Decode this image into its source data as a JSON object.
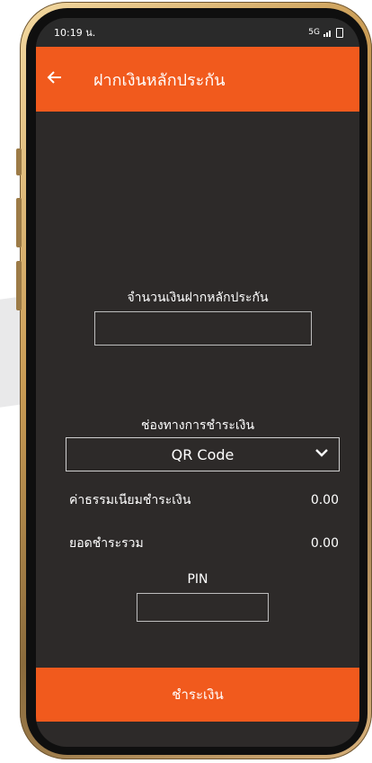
{
  "status_bar": {
    "time": "10:19 น.",
    "network": "5G"
  },
  "app_bar": {
    "title": "ฝากเงินหลักประกัน",
    "back_icon": "arrow-left-icon"
  },
  "form": {
    "amount_label": "จำนวนเงินฝากหลักประกัน",
    "amount_value": "",
    "channel_label": "ช่องทางการชำระเงิน",
    "channel_selected": "QR Code",
    "fee_label": "ค่าธรรมเนียมชำระเงิน",
    "fee_value": "0.00",
    "total_label": "ยอดชำระรวม",
    "total_value": "0.00",
    "pin_label": "PIN",
    "pin_value": ""
  },
  "actions": {
    "pay_label": "ชำระเงิน"
  },
  "colors": {
    "accent": "#f15a1d",
    "background": "#2d2a29",
    "text": "#ffffff"
  }
}
